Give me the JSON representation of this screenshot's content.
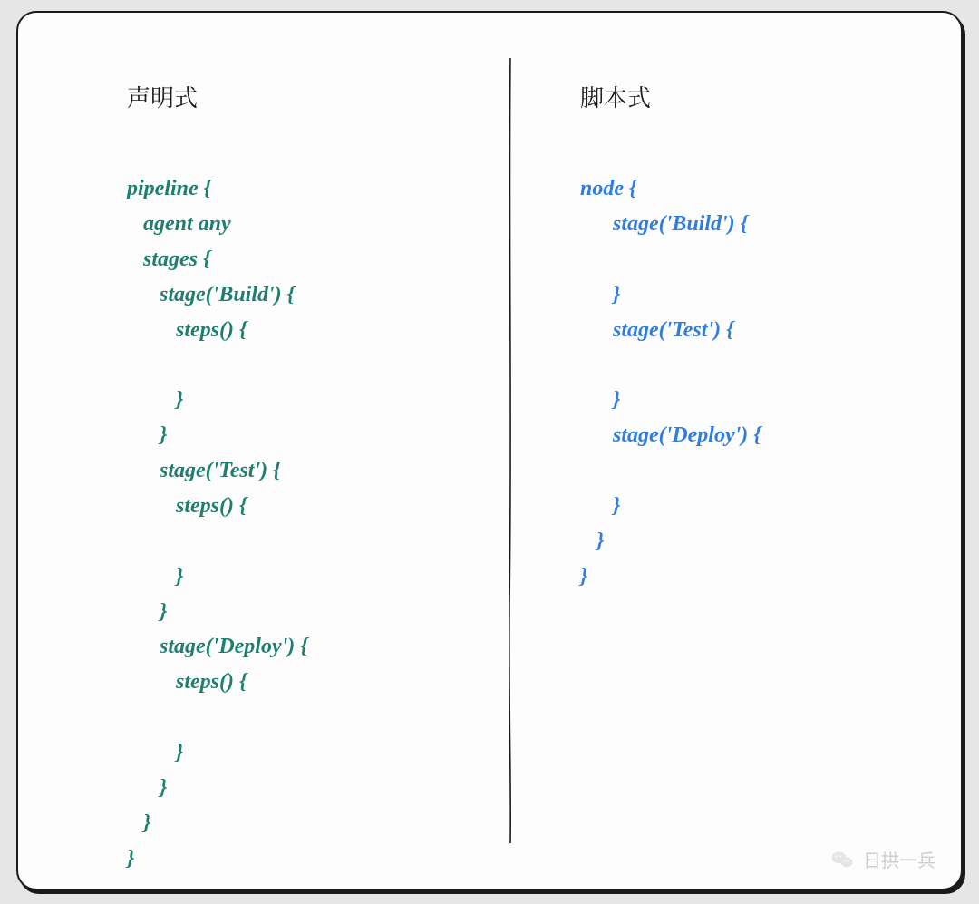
{
  "left": {
    "title": "声明式",
    "code": "pipeline {\n   agent any\n   stages {\n      stage('Build') {\n         steps() {\n\n         }\n      }\n      stage('Test') {\n         steps() {\n\n         }\n      }\n      stage('Deploy') {\n         steps() {\n\n         }\n      }\n   }\n}"
  },
  "right": {
    "title": "脚本式",
    "code": "node {\n      stage('Build') {\n\n      }\n      stage('Test') {\n\n      }\n      stage('Deploy') {\n\n      }\n   }\n}"
  },
  "watermark": {
    "label": "日拱一兵"
  }
}
